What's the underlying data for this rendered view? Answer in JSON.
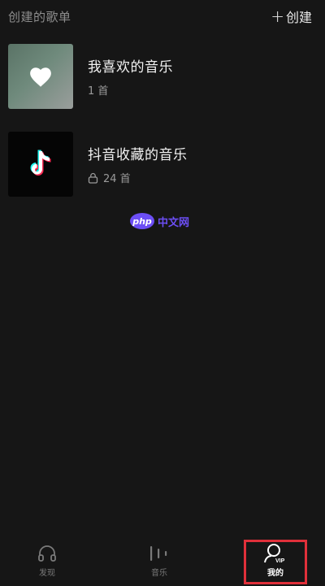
{
  "header": {
    "title": "创建的歌单",
    "create_label": "创建"
  },
  "playlists": [
    {
      "name": "我喜欢的音乐",
      "count": "1 首",
      "cover_icon": "heart-icon",
      "locked": false
    },
    {
      "name": "抖音收藏的音乐",
      "count": "24 首",
      "cover_icon": "tiktok-logo-icon",
      "locked": true
    }
  ],
  "watermark": {
    "badge": "php",
    "text": "中文网"
  },
  "tabbar": {
    "items": [
      {
        "label": "发现",
        "icon": "headphones-icon",
        "active": false
      },
      {
        "label": "音乐",
        "icon": "music-bars-icon",
        "active": false
      },
      {
        "label": "我的",
        "icon": "user-vip-icon",
        "active": true,
        "badge": "VIP"
      }
    ]
  },
  "colors": {
    "background": "#161616",
    "highlight": "#e0303a",
    "watermark": "#6c4ef5"
  }
}
